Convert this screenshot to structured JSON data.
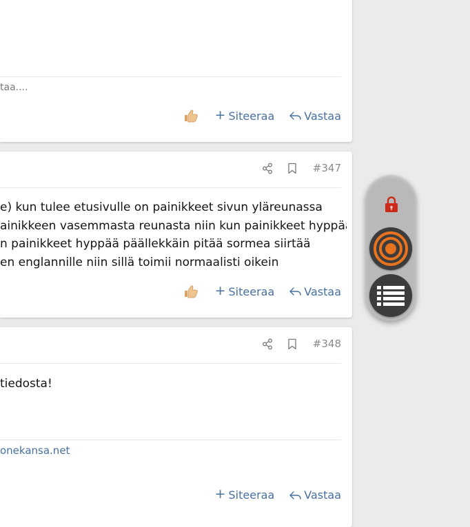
{
  "posts": [
    {
      "signature": "taa....",
      "actions": {
        "quote": "Siteeraa",
        "reply": "Vastaa"
      }
    },
    {
      "number": "#347",
      "lines": [
        "e) kun tulee etusivulle on painikkeet sivun yläreunassa",
        "ainikkeen vasemmasta reunasta niin kun painikkeet hyppää",
        "n painikkeet hyppää päällekkäin pitää sormea siirtää",
        "en englannille niin sillä toimii normaalisti oikein"
      ],
      "actions": {
        "quote": "Siteeraa",
        "reply": "Vastaa"
      }
    },
    {
      "number": "#348",
      "lines": [
        "tiedosta!"
      ],
      "signature_link": "onekansa.net",
      "actions": {
        "quote": "Siteeraa",
        "reply": "Vastaa"
      }
    }
  ],
  "float_panel": {
    "icons": [
      "lock-icon",
      "target-icon",
      "list-icon"
    ],
    "lock_color": "#cc2a1a",
    "target_color": "#e8731e"
  },
  "colors": {
    "link": "#47709e",
    "background": "#ebebeb"
  }
}
